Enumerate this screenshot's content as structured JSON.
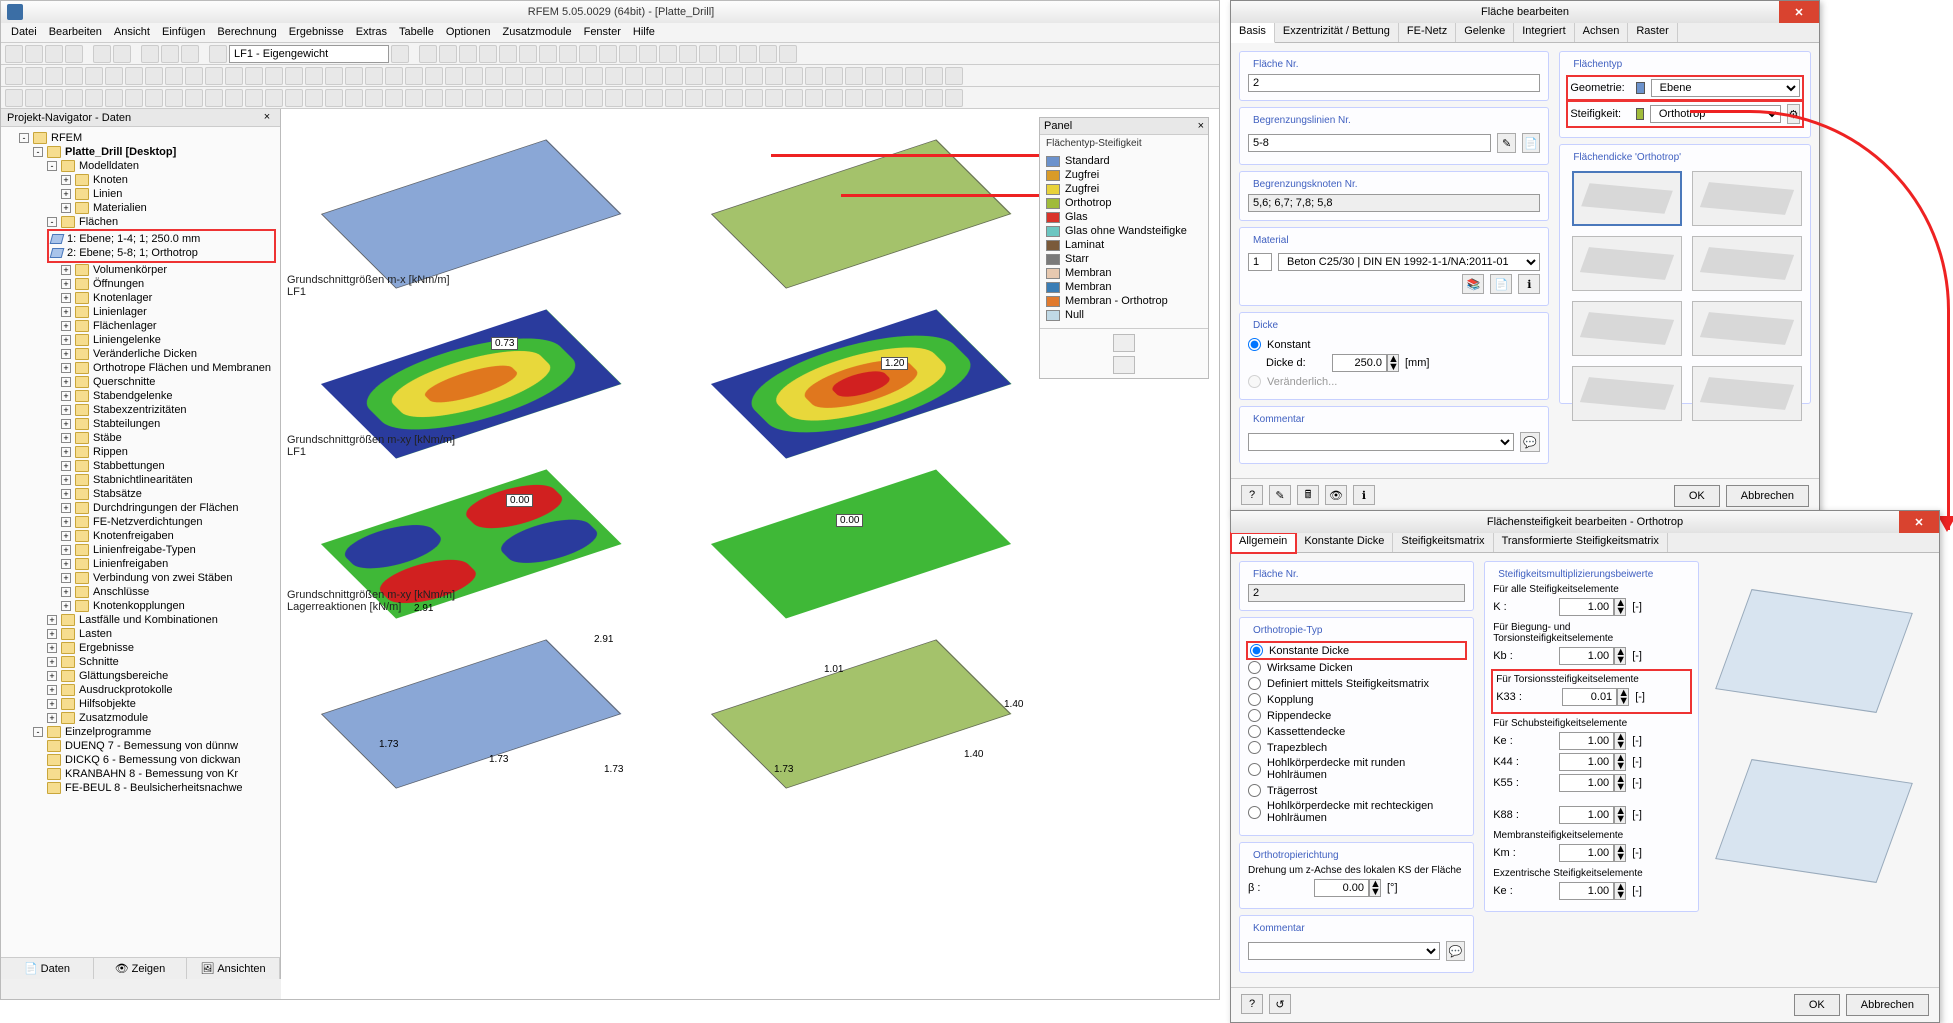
{
  "app": {
    "title": "RFEM 5.05.0029 (64bit) - [Platte_Drill]",
    "menu": [
      "Datei",
      "Bearbeiten",
      "Ansicht",
      "Einfügen",
      "Berechnung",
      "Ergebnisse",
      "Extras",
      "Tabelle",
      "Optionen",
      "Zusatzmodule",
      "Fenster",
      "Hilfe"
    ],
    "loadcase": "LF1 - Eigengewicht"
  },
  "navigator": {
    "title": "Projekt-Navigator - Daten",
    "root": "RFEM",
    "project": "Platte_Drill [Desktop]",
    "modelldaten": "Modelldaten",
    "items_top": [
      "Knoten",
      "Linien",
      "Materialien"
    ],
    "flaechen": "Flächen",
    "flaechen_items": [
      "1: Ebene; 1-4; 1; 250.0 mm",
      "2: Ebene; 5-8; 1; Orthotrop"
    ],
    "items_mid": [
      "Volumenkörper",
      "Öffnungen",
      "Knotenlager",
      "Linienlager",
      "Flächenlager",
      "Liniengelenke",
      "Veränderliche Dicken",
      "Orthotrope Flächen und Membranen",
      "Querschnitte",
      "Stabendgelenke",
      "Stabexzentrizitäten",
      "Stabteilungen",
      "Stäbe",
      "Rippen",
      "Stabbettungen",
      "Stabnichtlinearitäten",
      "Stabsätze",
      "Durchdringungen der Flächen",
      "FE-Netzverdichtungen",
      "Knotenfreigaben",
      "Linienfreigabe-Typen",
      "Linienfreigaben",
      "Verbindung von zwei Stäben",
      "Anschlüsse",
      "Knotenkopplungen"
    ],
    "items_after": [
      "Lastfälle und Kombinationen",
      "Lasten",
      "Ergebnisse",
      "Schnitte",
      "Glättungsbereiche",
      "Ausdruckprotokolle",
      "Hilfsobjekte",
      "Zusatzmodule"
    ],
    "einzelprogramme": "Einzelprogramme",
    "programs": [
      "DUENQ 7 - Bemessung von dünnw",
      "DICKQ 6 - Bemessung von dickwan",
      "KRANBAHN 8 - Bemessung von Kr",
      "FE-BEUL 8 - Beulsicherheitsnachwe"
    ],
    "tabs": [
      "Daten",
      "Zeigen",
      "Ansichten"
    ]
  },
  "plots": {
    "r1": "Grundschnittgrößen m-x [kNm/m]\nLF1",
    "r2": "Grundschnittgrößen m-xy [kNm/m]\nLF1",
    "r3": "Grundschnittgrößen m-xy [kNm/m]\nLagerreaktionen [kN/m]",
    "v1": "0.73",
    "v2": "1.20",
    "v3a": "0.00",
    "v3b": "0.00",
    "react_vals": [
      "2.91",
      "2.91",
      "1.73",
      "1.73",
      "1.73",
      "1.73",
      "1.01",
      "1.40",
      "1.40"
    ]
  },
  "legend": {
    "panel": "Panel",
    "subtitle": "Flächentyp-Steifigkeit",
    "items": [
      {
        "c": "#6c92cc",
        "t": "Standard"
      },
      {
        "c": "#d99b28",
        "t": "Zugfrei"
      },
      {
        "c": "#e8d23b",
        "t": "Zugfrei"
      },
      {
        "c": "#a0bb3b",
        "t": "Orthotrop"
      },
      {
        "c": "#d9332a",
        "t": "Glas"
      },
      {
        "c": "#6cc6c1",
        "t": "Glas ohne Wandsteifigke"
      },
      {
        "c": "#7a5a3a",
        "t": "Laminat"
      },
      {
        "c": "#7a7a7a",
        "t": "Starr"
      },
      {
        "c": "#e7c9b0",
        "t": "Membran"
      },
      {
        "c": "#3a7db5",
        "t": "Membran"
      },
      {
        "c": "#e07a2e",
        "t": "Membran - Orthotrop"
      },
      {
        "c": "#c0d9e6",
        "t": "Null"
      }
    ]
  },
  "dlg1": {
    "title": "Fläche bearbeiten",
    "tabs": [
      "Basis",
      "Exzentrizität / Bettung",
      "FE-Netz",
      "Gelenke",
      "Integriert",
      "Achsen",
      "Raster"
    ],
    "flaeche_nr_lbl": "Fläche Nr.",
    "flaeche_nr": "2",
    "begrenzlinien_lbl": "Begrenzungslinien Nr.",
    "begrenzlinien": "5-8",
    "begrenzknoten_lbl": "Begrenzungsknoten Nr.",
    "begrenzknoten": "5,6; 6,7; 7,8; 5,8",
    "material_lbl": "Material",
    "material_num": "1",
    "material": "Beton C25/30 | DIN EN 1992-1-1/NA:2011-01",
    "dicke_lbl": "Dicke",
    "dicke_konst": "Konstant",
    "dicke_d_lbl": "Dicke d:",
    "dicke_d": "250.0",
    "dicke_unit": "[mm]",
    "dicke_var": "Veränderlich...",
    "kommentar_lbl": "Kommentar",
    "typ_lbl": "Flächentyp",
    "geom_lbl": "Geometrie:",
    "geom": "Ebene",
    "steif_lbl": "Steifigkeit:",
    "steif": "Orthotrop",
    "tiles_lbl": "Flächendicke 'Orthotrop'",
    "ok": "OK",
    "cancel": "Abbrechen"
  },
  "dlg2": {
    "title": "Flächensteifigkeit bearbeiten - Orthotrop",
    "tabs": [
      "Allgemein",
      "Konstante Dicke",
      "Steifigkeitsmatrix",
      "Transformierte Steifigkeitsmatrix"
    ],
    "flaeche_nr_lbl": "Fläche Nr.",
    "flaeche_nr": "2",
    "ortho_typ_lbl": "Orthotropie-Typ",
    "ortho_types": [
      "Konstante Dicke",
      "Wirksame Dicken",
      "Definiert mittels Steifigkeitsmatrix",
      "Kopplung",
      "Rippendecke",
      "Kassettendecke",
      "Trapezblech",
      "Hohlkörperdecke mit runden Hohlräumen",
      "Trägerrost",
      "Hohlkörperdecke mit rechteckigen Hohlräumen"
    ],
    "richt_lbl": "Orthotropierichtung",
    "richt_txt": "Drehung um z-Achse des lokalen KS der Fläche",
    "beta_lbl": "β :",
    "beta": "0.00",
    "beta_unit": "[°]",
    "mult_lbl": "Steifigkeitsmultiplizierungsbeiwerte",
    "mult_all": "Für alle Steifigkeitselemente",
    "mult_biege": "Für Biegung- und Torsionsteifigkeitselemente",
    "mult_tors": "Für Torsionssteifigkeitselemente",
    "mult_schub": "Für Schubsteifigkeitselemente",
    "mult_memb": "Membransteifigkeitselemente",
    "mult_exz": "Exzentrische Steifigkeitselemente",
    "k_lbl": "K :",
    "k": "1.00",
    "kb_lbl": "Kb :",
    "kb": "1.00",
    "k33_lbl": "K33 :",
    "k33": "0.01",
    "ke_lbl": "Ke :",
    "ke": "1.00",
    "k44_lbl": "K44 :",
    "k44": "1.00",
    "k55_lbl": "K55 :",
    "k55": "1.00",
    "k88_lbl": "K88 :",
    "k88": "1.00",
    "km_lbl": "Km :",
    "km": "1.00",
    "kez_lbl": "Ke :",
    "kez": "1.00",
    "unit": "[-]",
    "kommentar_lbl": "Kommentar",
    "ok": "OK",
    "cancel": "Abbrechen"
  }
}
